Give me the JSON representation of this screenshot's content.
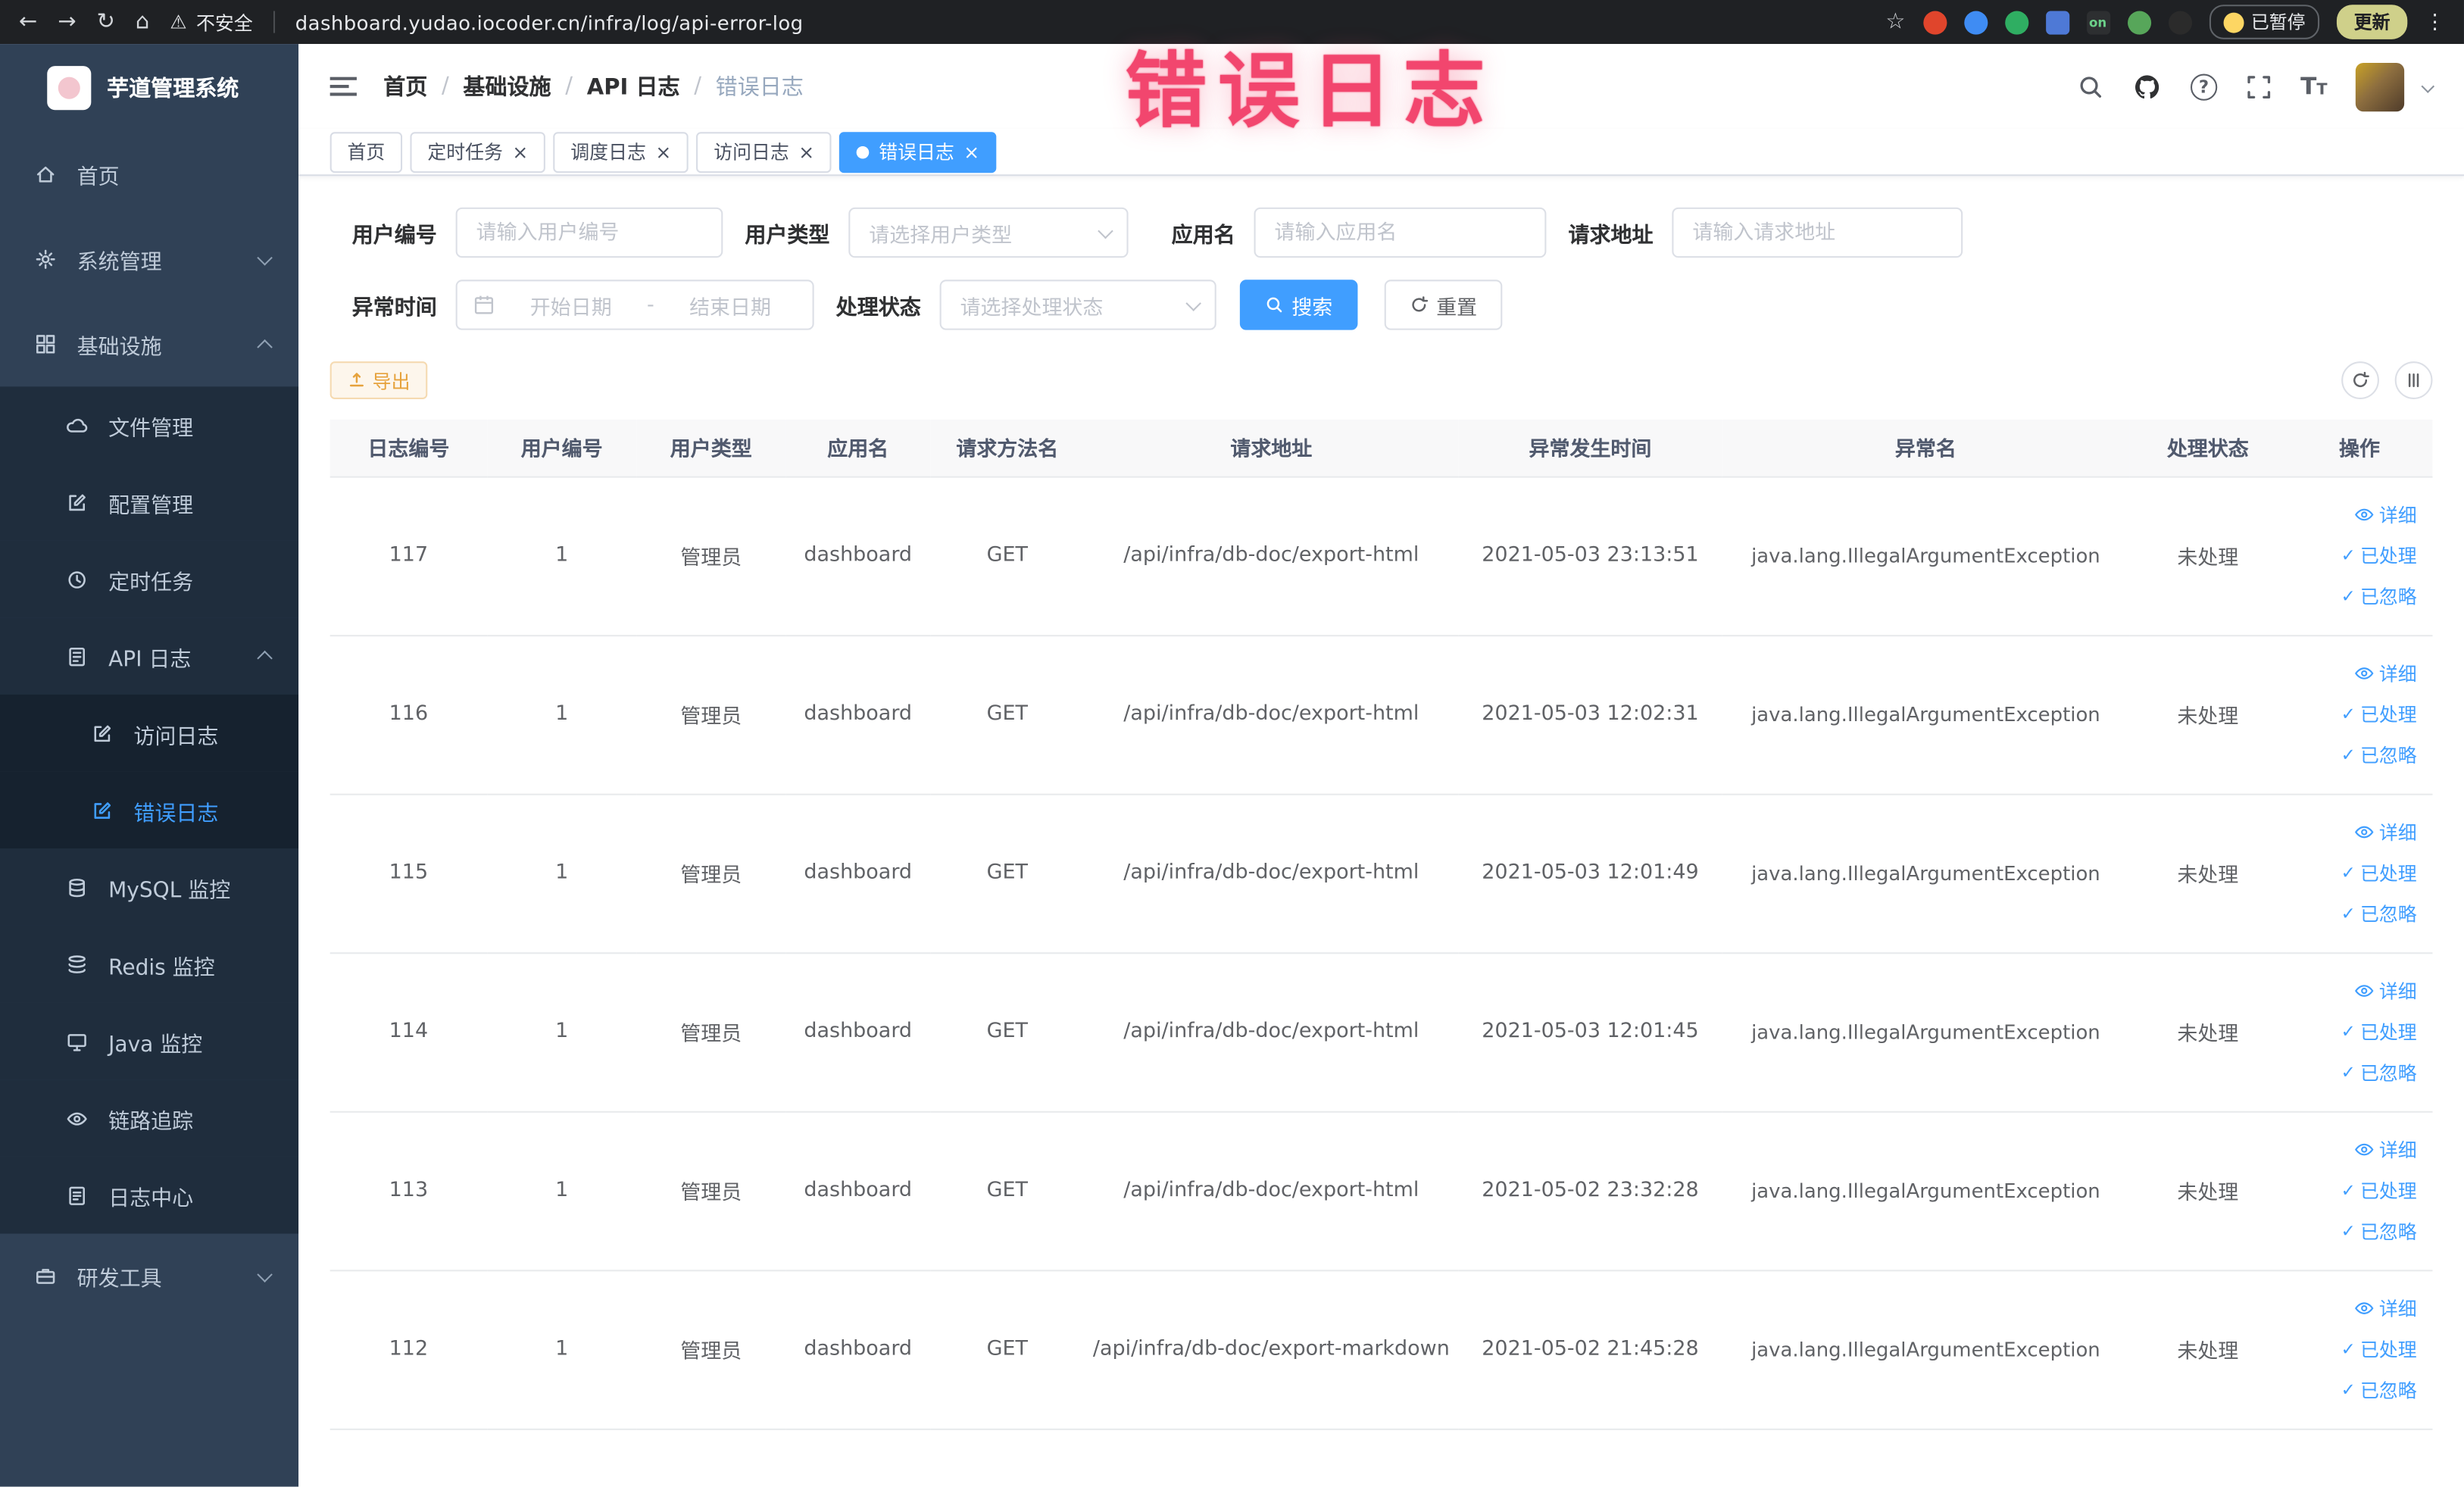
{
  "browser": {
    "security_label": "不安全",
    "url": "dashboard.yudao.iocoder.cn/infra/log/api-error-log",
    "extension_on_label": "on",
    "paused_label": "已暂停",
    "update_label": "更新"
  },
  "annotation": {
    "text": "错误日志"
  },
  "sidebar": {
    "logo_title": "芋道管理系统",
    "menu": [
      {
        "label": "首页",
        "icon": "home-icon"
      },
      {
        "label": "系统管理",
        "icon": "gear-icon",
        "state": "collapsed"
      },
      {
        "label": "基础设施",
        "icon": "infra-icon",
        "state": "expanded"
      },
      {
        "label": "文件管理",
        "icon": "file-cloud-icon"
      },
      {
        "label": "配置管理",
        "icon": "config-edit-icon"
      },
      {
        "label": "定时任务",
        "icon": "schedule-clock-icon"
      },
      {
        "label": "API 日志",
        "icon": "api-log-icon",
        "state": "expanded"
      },
      {
        "label": "访问日志",
        "icon": "access-log-icon"
      },
      {
        "label": "错误日志",
        "icon": "error-log-icon",
        "active": true
      },
      {
        "label": "MySQL 监控",
        "icon": "mysql-db-icon"
      },
      {
        "label": "Redis 监控",
        "icon": "redis-stack-icon"
      },
      {
        "label": "Java 监控",
        "icon": "java-monitor-icon"
      },
      {
        "label": "链路追踪",
        "icon": "trace-eye-icon"
      },
      {
        "label": "日志中心",
        "icon": "log-center-icon"
      },
      {
        "label": "研发工具",
        "icon": "devtools-icon",
        "state": "collapsed"
      }
    ]
  },
  "navbar": {
    "breadcrumb": [
      "首页",
      "基础设施",
      "API 日志",
      "错误日志"
    ],
    "breadcrumb_separator": "/"
  },
  "tabs": [
    {
      "label": "首页",
      "closable": false,
      "active": false
    },
    {
      "label": "定时任务",
      "closable": true,
      "active": false
    },
    {
      "label": "调度日志",
      "closable": true,
      "active": false
    },
    {
      "label": "访问日志",
      "closable": true,
      "active": false
    },
    {
      "label": "错误日志",
      "closable": true,
      "active": true
    }
  ],
  "filters": {
    "user_id": {
      "label": "用户编号",
      "placeholder": "请输入用户编号"
    },
    "user_type": {
      "label": "用户类型",
      "placeholder": "请选择用户类型"
    },
    "app_name": {
      "label": "应用名",
      "placeholder": "请输入应用名"
    },
    "request_url": {
      "label": "请求地址",
      "placeholder": "请输入请求地址"
    },
    "exception_time": {
      "label": "异常时间",
      "start_placeholder": "开始日期",
      "separator": "-",
      "end_placeholder": "结束日期"
    },
    "process_status": {
      "label": "处理状态",
      "placeholder": "请选择处理状态"
    },
    "search_label": "搜索",
    "reset_label": "重置"
  },
  "toolbar": {
    "export_label": "导出"
  },
  "table": {
    "headers": [
      "日志编号",
      "用户编号",
      "用户类型",
      "应用名",
      "请求方法名",
      "请求地址",
      "异常发生时间",
      "异常名",
      "处理状态",
      "操作"
    ],
    "action_labels": {
      "detail": "详细",
      "processed": "已处理",
      "ignored": "已忽略"
    },
    "rows": [
      {
        "id": "117",
        "user_id": "1",
        "user_type": "管理员",
        "app": "dashboard",
        "method": "GET",
        "url": "/api/infra/db-doc/export-html",
        "time": "2021-05-03 23:13:51",
        "exception": "java.lang.IllegalArgumentException",
        "status": "未处理"
      },
      {
        "id": "116",
        "user_id": "1",
        "user_type": "管理员",
        "app": "dashboard",
        "method": "GET",
        "url": "/api/infra/db-doc/export-html",
        "time": "2021-05-03 12:02:31",
        "exception": "java.lang.IllegalArgumentException",
        "status": "未处理"
      },
      {
        "id": "115",
        "user_id": "1",
        "user_type": "管理员",
        "app": "dashboard",
        "method": "GET",
        "url": "/api/infra/db-doc/export-html",
        "time": "2021-05-03 12:01:49",
        "exception": "java.lang.IllegalArgumentException",
        "status": "未处理"
      },
      {
        "id": "114",
        "user_id": "1",
        "user_type": "管理员",
        "app": "dashboard",
        "method": "GET",
        "url": "/api/infra/db-doc/export-html",
        "time": "2021-05-03 12:01:45",
        "exception": "java.lang.IllegalArgumentException",
        "status": "未处理"
      },
      {
        "id": "113",
        "user_id": "1",
        "user_type": "管理员",
        "app": "dashboard",
        "method": "GET",
        "url": "/api/infra/db-doc/export-html",
        "time": "2021-05-02 23:32:28",
        "exception": "java.lang.IllegalArgumentException",
        "status": "未处理"
      },
      {
        "id": "112",
        "user_id": "1",
        "user_type": "管理员",
        "app": "dashboard",
        "method": "GET",
        "url": "/api/infra/db-doc/export-markdown",
        "time": "2021-05-02 21:45:28",
        "exception": "java.lang.IllegalArgumentException",
        "status": "未处理"
      }
    ]
  },
  "colors": {
    "accent": "#409eff",
    "warning": "#e6a23c",
    "sidebar_bg": "#304156",
    "annotation": "#f2466e"
  }
}
